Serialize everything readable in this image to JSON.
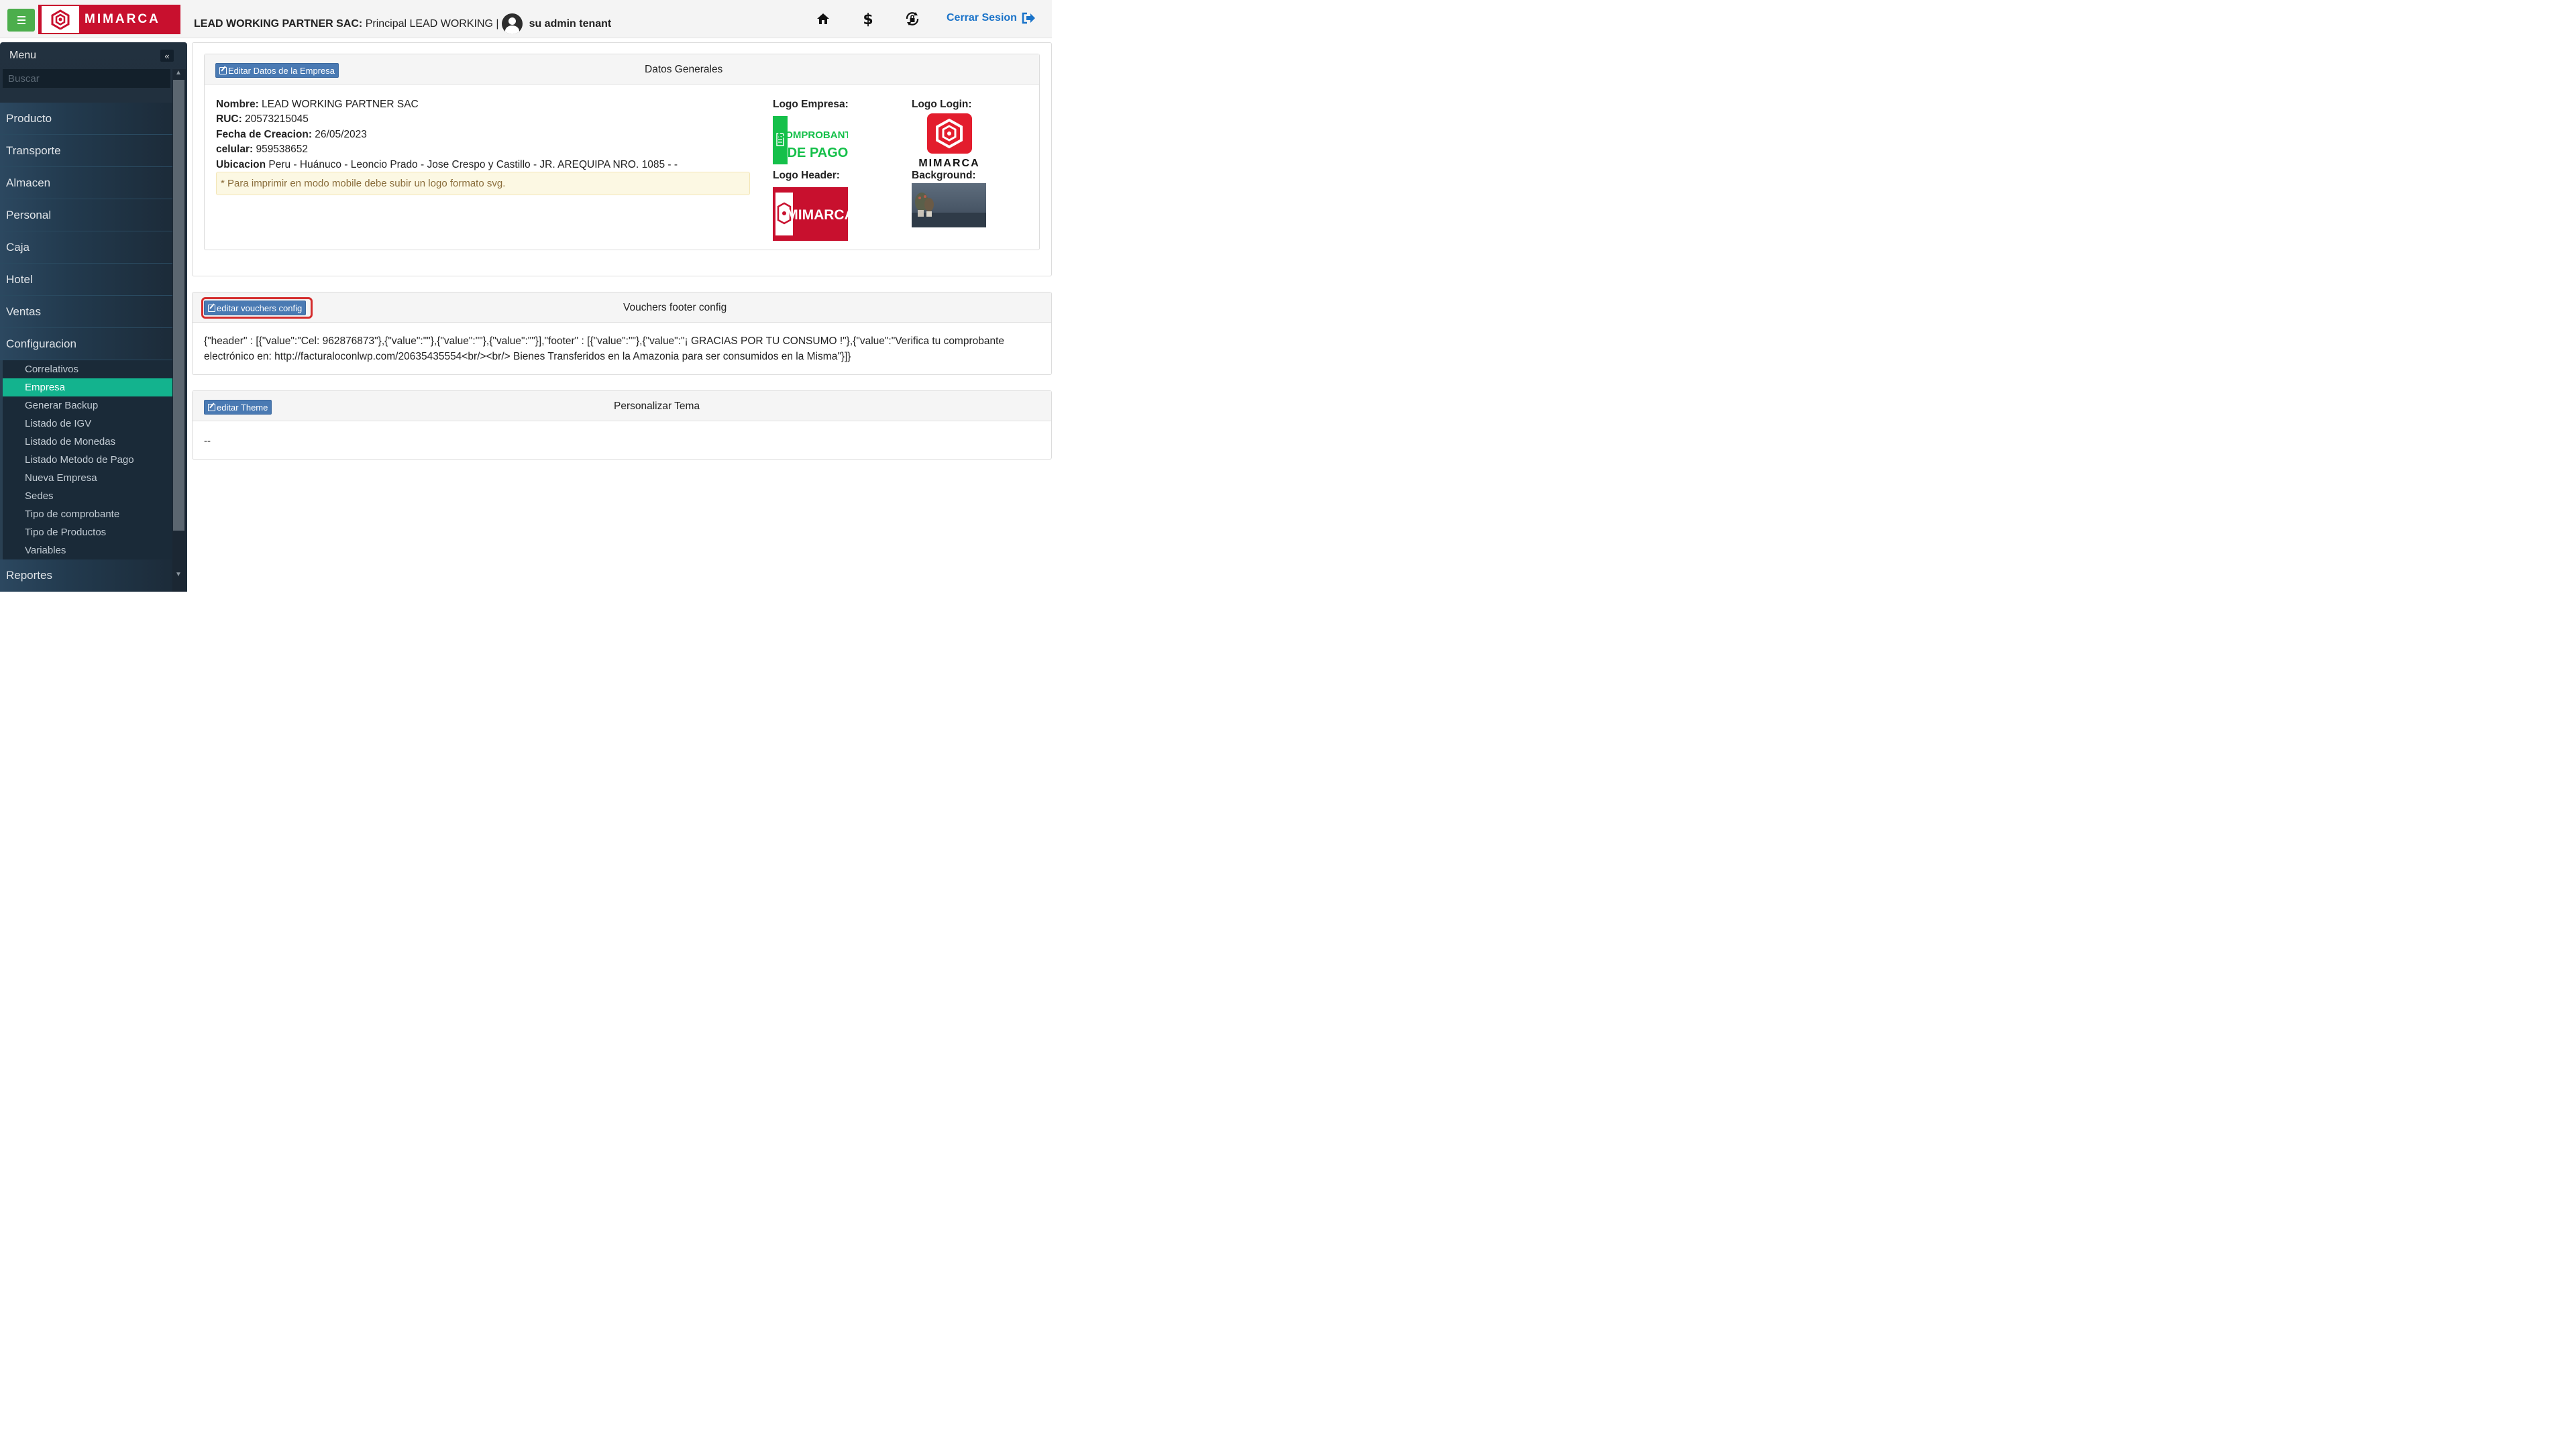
{
  "topbar": {
    "brand": "MIMARCA",
    "company_bold": "LEAD WORKING PARTNER SAC:",
    "company_rest": " Principal LEAD WORKING |",
    "user": "su admin tenant",
    "logout_label": "Cerrar Sesion",
    "icons": [
      "menu-icon",
      "home-icon",
      "dollar-icon",
      "lock-rotate-icon",
      "sign-out-icon"
    ]
  },
  "sidebar": {
    "title": "Menu",
    "search_placeholder": "Buscar",
    "items": [
      "Producto",
      "Transporte",
      "Almacen",
      "Personal",
      "Caja",
      "Hotel",
      "Ventas",
      "Configuracion"
    ],
    "subitems": [
      "Correlativos",
      "Empresa",
      "Generar Backup",
      "Listado de IGV",
      "Listado de Monedas",
      "Listado Metodo de Pago",
      "Nueva Empresa",
      "Sedes",
      "Tipo de comprobante",
      "Tipo de Productos",
      "Variables"
    ],
    "active_subitem": "Empresa",
    "bottom_item": "Reportes"
  },
  "datos": {
    "edit_label": "Editar Datos de la Empresa",
    "title": "Datos Generales",
    "nombre_label": "Nombre:",
    "nombre": " LEAD WORKING PARTNER SAC",
    "ruc_label": "RUC:",
    "ruc": " 20573215045",
    "fecha_label": "Fecha de Creacion:",
    "fecha": " 26/05/2023",
    "celular_label": "celular:",
    "celular": " 959538652",
    "ubicacion_label": "Ubicacion",
    "ubicacion": " Peru - Huánuco - Leoncio Prado - Jose Crespo y Castillo - JR. AREQUIPA NRO. 1085 - -",
    "alert": "* Para imprimir en modo mobile debe subir un logo formato svg.",
    "logo_empresa_label": "Logo Empresa:",
    "logo_login_label": "Logo Login:",
    "logo_header_label": "Logo Header:",
    "background_label": "Background:",
    "logo_empresa_text": [
      "COMPROBANTE",
      "DE PAGO"
    ],
    "logo_login_text": "MIMARCA",
    "logo_header_text": "MIMARCA"
  },
  "vouchers": {
    "edit_label": "editar vouchers config",
    "title": "Vouchers footer config",
    "content": "{\"header\" : [{\"value\":\"Cel: 962876873\"},{\"value\":\"\"},{\"value\":\"\"},{\"value\":\"\"}],\"footer\" : [{\"value\":\"\"},{\"value\":\"¡ GRACIAS POR TU CONSUMO !\"},{\"value\":\"Verifica tu comprobante electrónico en: http://facturaloconlwp.com/20635435554<br/><br/> Bienes Transferidos en la Amazonia para ser consumidos en la Misma\"}]}"
  },
  "theme": {
    "edit_label": "editar Theme",
    "title": "Personalizar Tema",
    "content": "--"
  },
  "colors": {
    "brand_red": "#c8102e",
    "active_green": "#13b38e",
    "button_blue": "#4a7ab3",
    "link_blue": "#1a73c9"
  }
}
